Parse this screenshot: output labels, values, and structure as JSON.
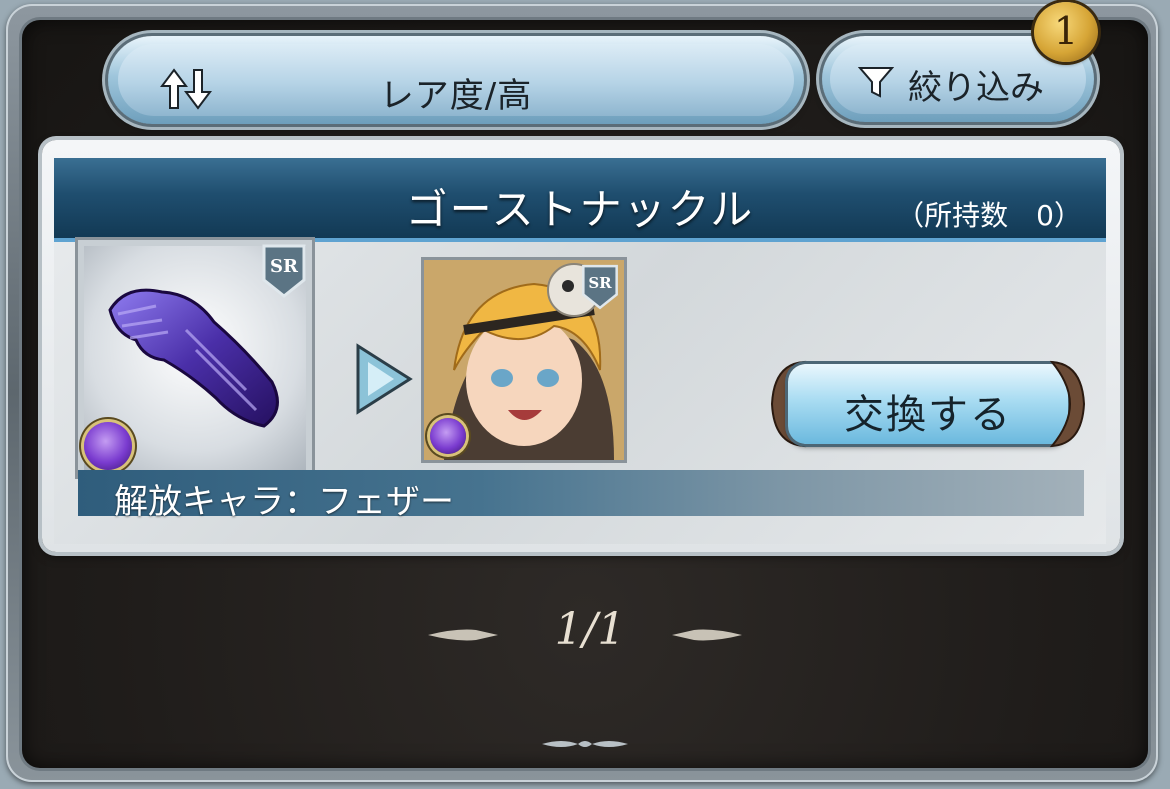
{
  "toolbar": {
    "sort_label": "レア度/高",
    "filter_label": "絞り込み",
    "filter_badge_count": "1"
  },
  "item": {
    "name": "ゴーストナックル",
    "owned_count_label": "（所持数　0）",
    "weapon_rarity": "SR",
    "character_rarity": "SR",
    "exchange_label": "交換する",
    "release_label": "解放キャラ：フェザー",
    "element_color": "#7a3bcf"
  },
  "pagination": {
    "page_label": "1/1"
  },
  "colors": {
    "panel_bg": "#1f1c1a",
    "title_bar": "#1f4e6f",
    "button_blue": "#9fc6dc",
    "badge_gold": "#d6a536"
  }
}
